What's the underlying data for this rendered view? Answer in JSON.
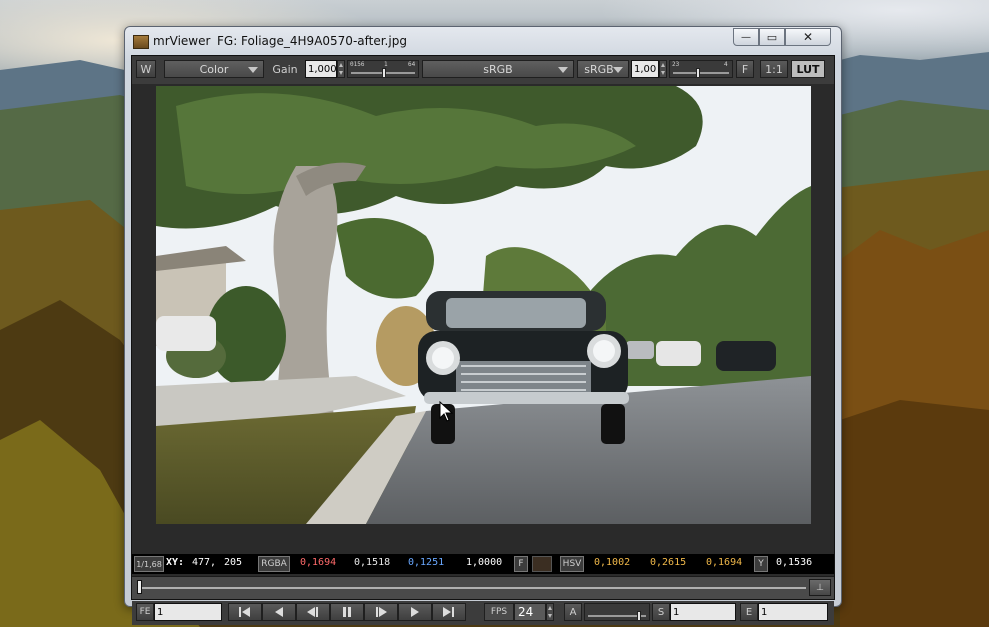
{
  "window": {
    "app_name": "mrViewer",
    "document_title": "FG: Foliage_4H9A0570-after.jpg",
    "minimize_glyph": "—",
    "maximize_glyph": "▭",
    "close_glyph": "✕"
  },
  "toolbar": {
    "wipe_label": "W",
    "channel_value": "Color",
    "gain_label": "Gain",
    "gain_value": "1,000",
    "gain_slider_min": "0156",
    "gain_slider_mid": "1",
    "gain_slider_max": "64",
    "gain_level": 0.52,
    "input_colorspace": "sRGB",
    "display_colorspace": "sRGB",
    "gamma_value": "1,00",
    "gamma_slider_min": "23",
    "gamma_slider_max": "4",
    "gamma_level": 0.45,
    "frame_label": "F",
    "zoom_label": "1:1",
    "lut_label": "LUT"
  },
  "pixel_bar": {
    "zoom": "1/1,68",
    "coord_label": "XY:",
    "x": "477,",
    "y": "205",
    "rgba_label": "RGBA",
    "r": "0,1694",
    "g": "0,1518",
    "b": "0,1251",
    "a": "1,0000",
    "f_label": "F",
    "swatch_color": "#3b2e22",
    "hsv_label": "HSV",
    "h": "0,1002",
    "s": "0,2615",
    "v": "0,1694",
    "y_label": "Y",
    "luma": "0,1536",
    "colors": {
      "r": "#ff6a6a",
      "g": "#e8e8e8",
      "b": "#6aa8ff",
      "a": "#ffffff",
      "hsv": "#f0b84a"
    }
  },
  "timeline": {
    "end_glyph": "⊥"
  },
  "transport": {
    "fe_label": "FE",
    "current_frame": "1",
    "fps_label": "FPS",
    "fps_value": "24",
    "a_label": "A",
    "s_label": "S",
    "start_frame": "1",
    "e_label": "E",
    "end_frame": "1",
    "volume_level": 0.9
  },
  "icons": [
    "app-icon",
    "minimize-icon",
    "maximize-icon",
    "close-icon",
    "first-frame-icon",
    "step-back-icon",
    "play-backward-icon",
    "stop-icon",
    "play-forward-icon",
    "step-forward-icon",
    "last-frame-icon",
    "mouse-cursor-icon"
  ]
}
